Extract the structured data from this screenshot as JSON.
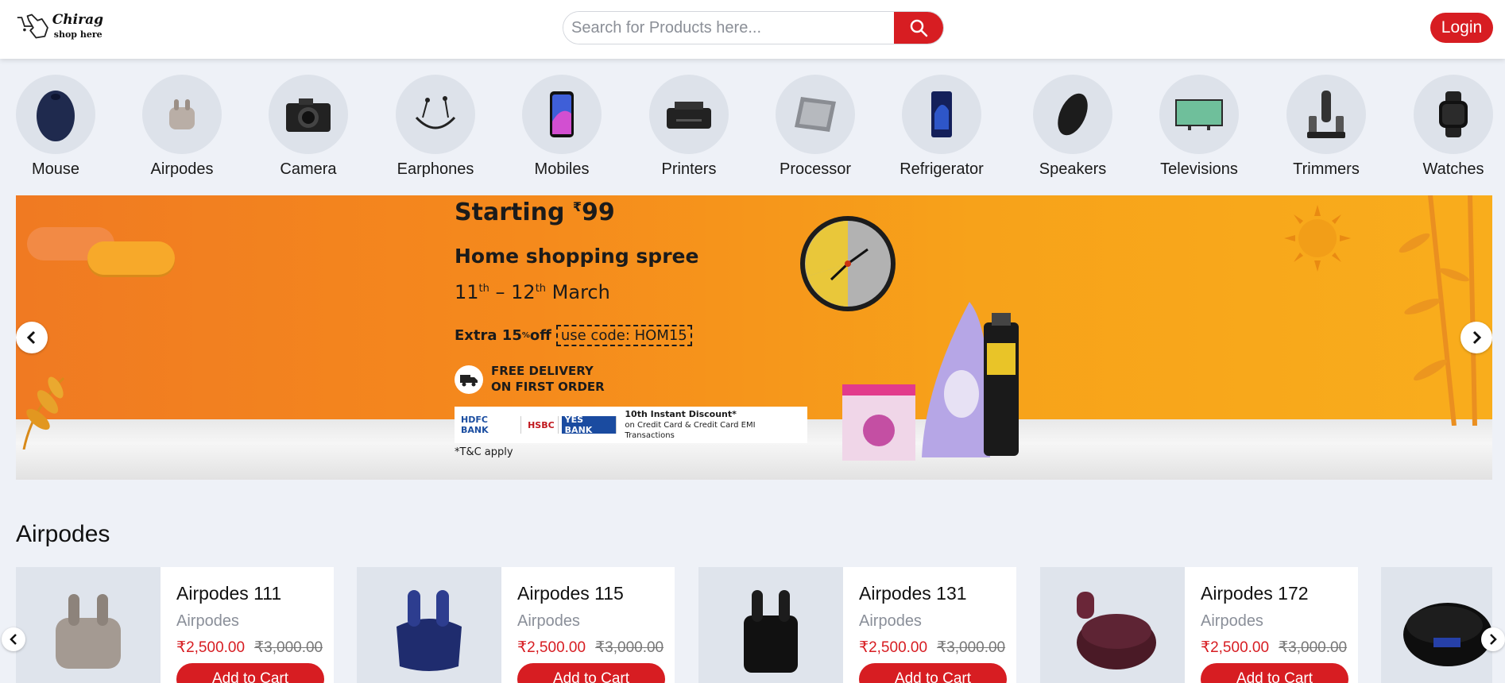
{
  "header": {
    "logo": {
      "title": "Chirag",
      "subtitle": "shop here"
    },
    "search": {
      "placeholder": "Search for Products here..."
    },
    "login_label": "Login"
  },
  "colors": {
    "accent": "#d71d22",
    "background": "#eef1f7"
  },
  "categories": [
    {
      "label": "Mouse",
      "icon": "mouse-icon"
    },
    {
      "label": "Airpodes",
      "icon": "airpods-icon"
    },
    {
      "label": "Camera",
      "icon": "camera-icon"
    },
    {
      "label": "Earphones",
      "icon": "earphones-icon"
    },
    {
      "label": "Mobiles",
      "icon": "mobile-icon"
    },
    {
      "label": "Printers",
      "icon": "printer-icon"
    },
    {
      "label": "Processor",
      "icon": "processor-icon"
    },
    {
      "label": "Refrigerator",
      "icon": "refrigerator-icon"
    },
    {
      "label": "Speakers",
      "icon": "speaker-icon"
    },
    {
      "label": "Televisions",
      "icon": "television-icon"
    },
    {
      "label": "Trimmers",
      "icon": "trimmer-icon"
    },
    {
      "label": "Watches",
      "icon": "watch-icon"
    }
  ],
  "banner": {
    "starting_prefix": "Starting ",
    "currency": "₹",
    "starting_price": "99",
    "headline": "Home shopping spree",
    "date_start": "11",
    "date_start_sup": "th",
    "date_sep": " – 12",
    "date_end_sup": "th",
    "date_month": " March",
    "extra": "Extra 15",
    "extra_sup": "%",
    "extra_off": " off",
    "code": "use code: HOM15",
    "delivery_line1": "FREE DELIVERY",
    "delivery_line2": "ON FIRST ORDER",
    "banks": [
      "HDFC BANK",
      "HSBC",
      "YES BANK"
    ],
    "discount_title": "10th Instant Discount*",
    "discount_sub": "on Credit Card & Credit Card EMI Transactions",
    "tc": "*T&C apply"
  },
  "section": {
    "title": "Airpodes",
    "products": [
      {
        "name": "Airpodes 111",
        "category": "Airpodes",
        "price": "₹2,500.00",
        "mrp": "₹3,000.00",
        "cta": "Add to Cart"
      },
      {
        "name": "Airpodes 115",
        "category": "Airpodes",
        "price": "₹2,500.00",
        "mrp": "₹3,000.00",
        "cta": "Add to Cart"
      },
      {
        "name": "Airpodes 131",
        "category": "Airpodes",
        "price": "₹2,500.00",
        "mrp": "₹3,000.00",
        "cta": "Add to Cart"
      },
      {
        "name": "Airpodes 172",
        "category": "Airpodes",
        "price": "₹2,500.00",
        "mrp": "₹3,000.00",
        "cta": "Add to Cart"
      }
    ]
  }
}
